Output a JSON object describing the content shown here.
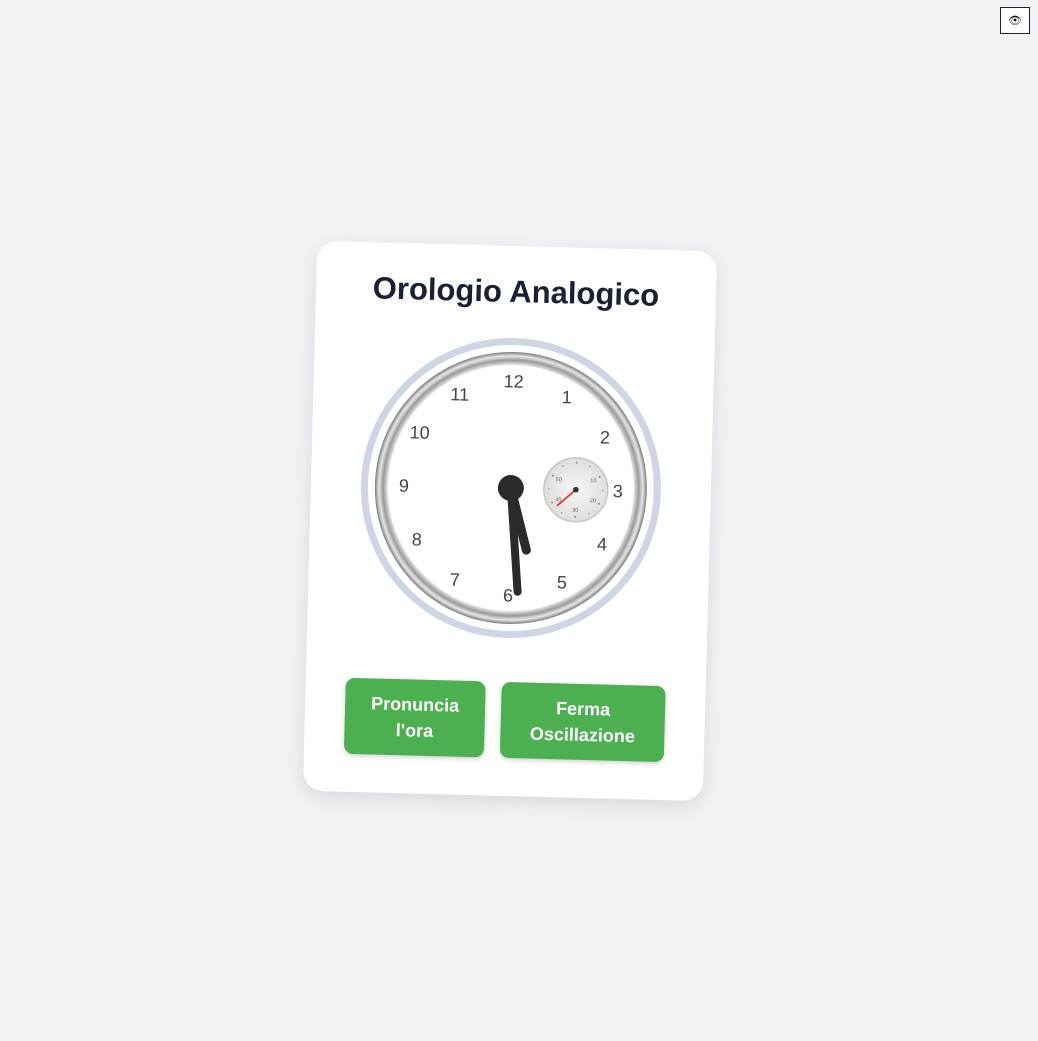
{
  "toolbar": {
    "toggle_icon": "👁"
  },
  "card": {
    "title": "Orologio Analogico"
  },
  "clock": {
    "numbers": [
      "12",
      "1",
      "2",
      "3",
      "4",
      "5",
      "6",
      "7",
      "8",
      "9",
      "10",
      "11"
    ],
    "subdial_labels": [
      "10",
      "20",
      "30",
      "40",
      "50"
    ],
    "time": {
      "hour": 5,
      "minute": 29,
      "second": 8
    },
    "colors": {
      "bezel_outer": "#cdd6e2",
      "ring_dark": "#7a7a7a",
      "ring_light": "#e8e8e8",
      "face": "#ffffff",
      "numbers": "#444444",
      "hands": "#2b2b2b",
      "subdial_face": "#ececec",
      "subdial_hand": "#e53935"
    }
  },
  "buttons": {
    "speak_label": "Pronuncia l'ora",
    "stop_label": "Ferma Oscillazione",
    "color": "#4caf50"
  }
}
